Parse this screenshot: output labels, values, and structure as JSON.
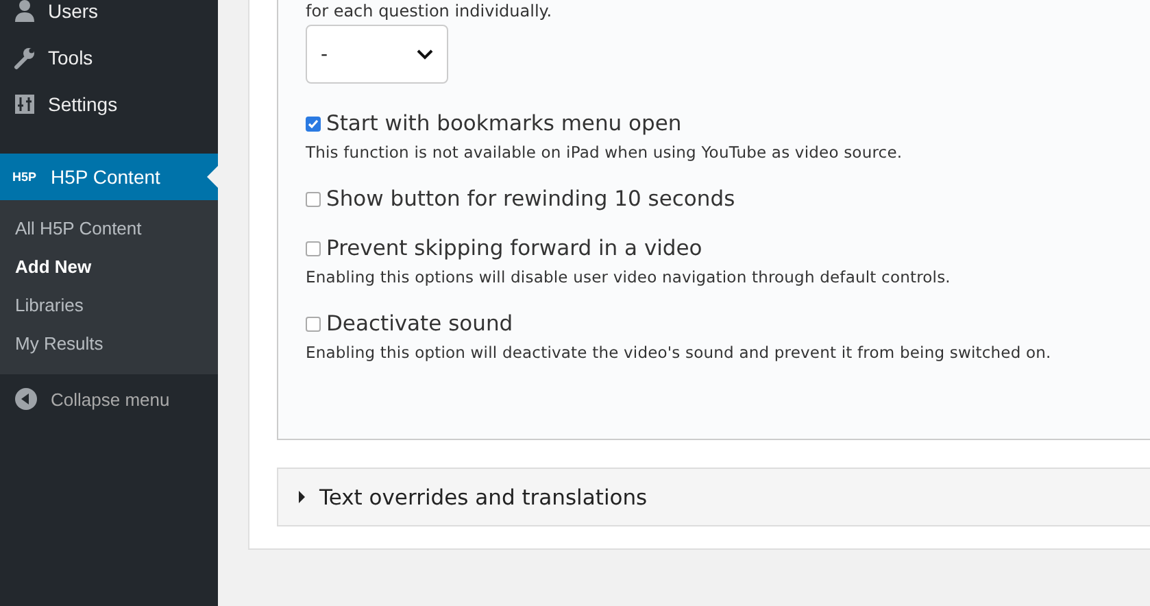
{
  "sidebar": {
    "menu": [
      {
        "kind": "users",
        "label": "Users",
        "selected": false
      },
      {
        "kind": "tools",
        "label": "Tools",
        "selected": false
      },
      {
        "kind": "settings",
        "label": "Settings",
        "selected": false
      },
      {
        "kind": "h5p",
        "label": "H5P Content",
        "icon_text": "H5P",
        "selected": true
      }
    ],
    "submenu": [
      {
        "label": "All H5P Content",
        "selected": false
      },
      {
        "label": "Add New",
        "selected": true
      },
      {
        "label": "Libraries",
        "selected": false
      },
      {
        "label": "My Results",
        "selected": false
      }
    ],
    "collapse": "Collapse menu"
  },
  "form": {
    "intro": "for each question individually.",
    "select_value": "-",
    "options": [
      {
        "label": "Start with bookmarks menu open",
        "checked": true,
        "description": "This function is not available on iPad when using YouTube as video source."
      },
      {
        "label": "Show button for rewinding 10 seconds",
        "checked": false
      },
      {
        "label": "Prevent skipping forward in a video",
        "checked": false,
        "description": "Enabling this options will disable user video navigation through default controls."
      },
      {
        "label": "Deactivate sound",
        "checked": false,
        "description": "Enabling this option will deactivate the video's sound and prevent it from being switched on."
      }
    ],
    "group": {
      "title": "Text overrides and translations",
      "expanded": false
    }
  }
}
